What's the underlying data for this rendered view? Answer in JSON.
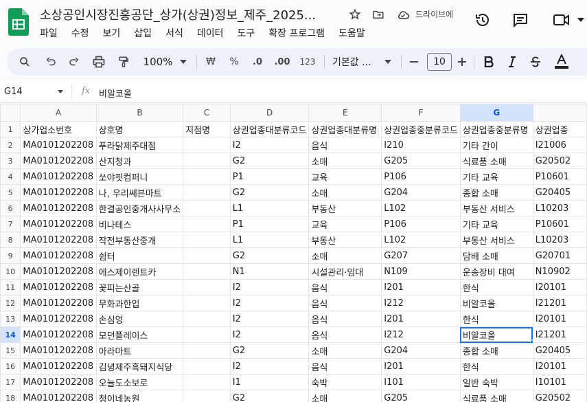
{
  "app": {
    "doc_title": "소상공인시장진흥공단_상가(상권)정보_제주_2025...",
    "drive_status": "드라이브에",
    "brand_color": "#0f9d58",
    "accent": "#1a73e8"
  },
  "menu": [
    "파일",
    "수정",
    "보기",
    "삽입",
    "서식",
    "데이터",
    "도구",
    "확장 프로그램",
    "도움말"
  ],
  "toolbar": {
    "zoom": "100%",
    "currency": "₩",
    "percent": "%",
    "decrease_decimal": ".0",
    "increase_decimal": ".00",
    "number_format": "123",
    "font": "기본값 ...",
    "font_size": "10"
  },
  "formula_bar": {
    "name_box": "G14",
    "fx": "fx",
    "formula": "비알코올"
  },
  "grid": {
    "columns": [
      "A",
      "B",
      "C",
      "D",
      "E",
      "F",
      "G",
      ""
    ],
    "active_column": "G",
    "active_row": "14",
    "rows": [
      {
        "num": "1",
        "cells": [
          "상가업소번호",
          "상호명",
          "지점명",
          "상권업종대분류코드",
          "상권업종대분류명",
          "상권업종중분류코드",
          "상권업종중분류명",
          "상권업종"
        ]
      },
      {
        "num": "2",
        "cells": [
          "MA0101202208",
          "푸라닭제주대점",
          "",
          "I2",
          "음식",
          "I210",
          "기타 간이",
          "I21006"
        ]
      },
      {
        "num": "3",
        "cells": [
          "MA0101202208",
          "산지청과",
          "",
          "G2",
          "소매",
          "G205",
          "식료품 소매",
          "G20502"
        ]
      },
      {
        "num": "4",
        "cells": [
          "MA0101202208",
          "쏘야핏컴퍼니",
          "",
          "P1",
          "교육",
          "P106",
          "기타 교육",
          "P10601"
        ]
      },
      {
        "num": "5",
        "cells": [
          "MA0101202208",
          "나, 우리쎄븐마트",
          "",
          "G2",
          "소매",
          "G204",
          "종합 소매",
          "G20405"
        ]
      },
      {
        "num": "6",
        "cells": [
          "MA0101202208",
          "한결공인중개사사무소",
          "",
          "L1",
          "부동산",
          "L102",
          "부동산 서비스",
          "L10203"
        ]
      },
      {
        "num": "7",
        "cells": [
          "MA0101202208",
          "비나테스",
          "",
          "P1",
          "교육",
          "P106",
          "기타 교육",
          "P10601"
        ]
      },
      {
        "num": "8",
        "cells": [
          "MA0101202208",
          "작전부동산중개",
          "",
          "L1",
          "부동산",
          "L102",
          "부동산 서비스",
          "L10203"
        ]
      },
      {
        "num": "9",
        "cells": [
          "MA0101202208",
          "쉼터",
          "",
          "G2",
          "소매",
          "G207",
          "담배 소매",
          "G20701"
        ]
      },
      {
        "num": "10",
        "cells": [
          "MA0101202208",
          "에스제이렌트카",
          "",
          "N1",
          "시설관리·임대",
          "N109",
          "운송장비 대여",
          "N10902"
        ]
      },
      {
        "num": "11",
        "cells": [
          "MA0101202208",
          "꽃피는산골",
          "",
          "I2",
          "음식",
          "I201",
          "한식",
          "I20101"
        ]
      },
      {
        "num": "12",
        "cells": [
          "MA0101202208",
          "무화과한입",
          "",
          "I2",
          "음식",
          "I212",
          "비알코올",
          "I21201"
        ]
      },
      {
        "num": "13",
        "cells": [
          "MA0101202208",
          "손심엉",
          "",
          "I2",
          "음식",
          "I201",
          "한식",
          "I20101"
        ]
      },
      {
        "num": "14",
        "cells": [
          "MA0101202208",
          "모던플레이스",
          "",
          "I2",
          "음식",
          "I212",
          "비알코올",
          "I21201"
        ]
      },
      {
        "num": "15",
        "cells": [
          "MA0101202208",
          "아라마트",
          "",
          "G2",
          "소매",
          "G204",
          "종합 소매",
          "G20405"
        ]
      },
      {
        "num": "16",
        "cells": [
          "MA0101202208",
          "김녕제주흑돼지식당",
          "",
          "I2",
          "음식",
          "I201",
          "한식",
          "I20101"
        ]
      },
      {
        "num": "17",
        "cells": [
          "MA0101202208",
          "오늘도소보로",
          "",
          "I1",
          "숙박",
          "I101",
          "일반 숙박",
          "I10101"
        ]
      },
      {
        "num": "18",
        "cells": [
          "MA0101202208",
          "청이네농원",
          "",
          "G2",
          "소매",
          "G205",
          "식료품 소매",
          "G20502"
        ]
      }
    ]
  }
}
